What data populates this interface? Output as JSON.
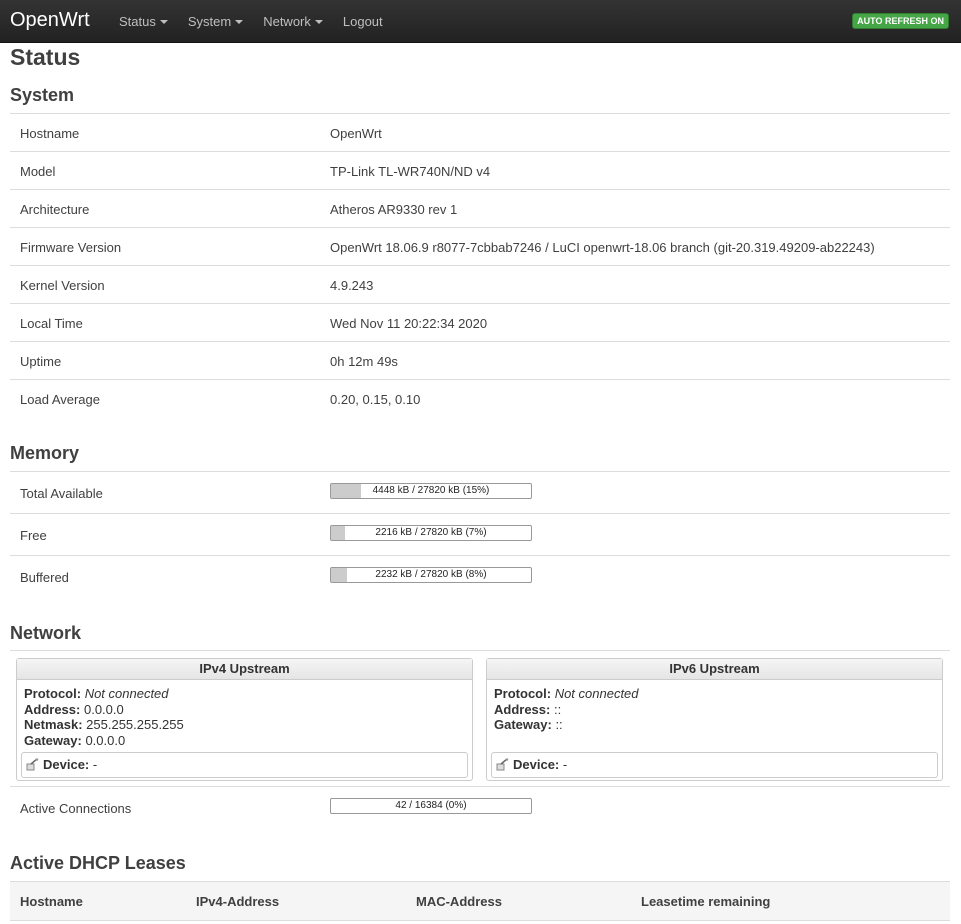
{
  "navbar": {
    "brand": "OpenWrt",
    "menu": [
      {
        "label": "Status",
        "dropdown": true
      },
      {
        "label": "System",
        "dropdown": true
      },
      {
        "label": "Network",
        "dropdown": true
      },
      {
        "label": "Logout",
        "dropdown": false
      }
    ],
    "auto_refresh": "AUTO REFRESH ON"
  },
  "page_title": "Status",
  "system": {
    "heading": "System",
    "rows": [
      {
        "key": "Hostname",
        "value": "OpenWrt"
      },
      {
        "key": "Model",
        "value": "TP-Link TL-WR740N/ND v4"
      },
      {
        "key": "Architecture",
        "value": "Atheros AR9330 rev 1"
      },
      {
        "key": "Firmware Version",
        "value": "OpenWrt 18.06.9 r8077-7cbbab7246 / LuCI openwrt-18.06 branch (git-20.319.49209-ab22243)"
      },
      {
        "key": "Kernel Version",
        "value": "4.9.243"
      },
      {
        "key": "Local Time",
        "value": "Wed Nov 11 20:22:34 2020"
      },
      {
        "key": "Uptime",
        "value": "0h 12m 49s"
      },
      {
        "key": "Load Average",
        "value": "0.20, 0.15, 0.10"
      }
    ]
  },
  "memory": {
    "heading": "Memory",
    "rows": [
      {
        "key": "Total Available",
        "label": "4448 kB / 27820 kB (15%)",
        "percent": 15
      },
      {
        "key": "Free",
        "label": "2216 kB / 27820 kB (7%)",
        "percent": 7
      },
      {
        "key": "Buffered",
        "label": "2232 kB / 27820 kB (8%)",
        "percent": 8
      }
    ]
  },
  "network": {
    "heading": "Network",
    "ipv4": {
      "title": "IPv4 Upstream",
      "protocol_label": "Protocol:",
      "protocol": "Not connected",
      "address_label": "Address:",
      "address": "0.0.0.0",
      "netmask_label": "Netmask:",
      "netmask": "255.255.255.255",
      "gateway_label": "Gateway:",
      "gateway": "0.0.0.0",
      "device_label": "Device:",
      "device": "-"
    },
    "ipv6": {
      "title": "IPv6 Upstream",
      "protocol_label": "Protocol:",
      "protocol": "Not connected",
      "address_label": "Address:",
      "address": "::",
      "gateway_label": "Gateway:",
      "gateway": "::",
      "device_label": "Device:",
      "device": "-"
    },
    "active_connections": {
      "key": "Active Connections",
      "label": "42 / 16384 (0%)",
      "percent": 0
    }
  },
  "dhcp": {
    "heading": "Active DHCP Leases",
    "columns": [
      "Hostname",
      "IPv4-Address",
      "MAC-Address",
      "Leasetime remaining"
    ]
  },
  "colors": {
    "navbar": "#222222",
    "badge": "#46a546",
    "bar_fill": "#cccccc"
  }
}
